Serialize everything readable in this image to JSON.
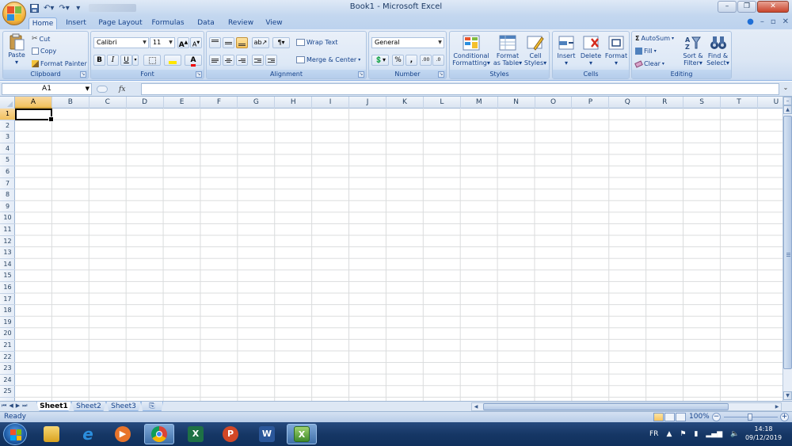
{
  "window": {
    "title": "Book1 - Microsoft Excel"
  },
  "tabs": [
    "Home",
    "Insert",
    "Page Layout",
    "Formulas",
    "Data",
    "Review",
    "View"
  ],
  "ribbon": {
    "clipboard": {
      "paste": "Paste",
      "cut": "Cut",
      "copy": "Copy",
      "format_painter": "Format Painter",
      "label": "Clipboard"
    },
    "font": {
      "name": "Calibri",
      "size": "11",
      "bold": "B",
      "italic": "I",
      "underline": "U",
      "grow": "A",
      "shrink": "A",
      "color_a": "A",
      "label": "Font"
    },
    "alignment": {
      "wrap_text": "Wrap Text",
      "merge_center": "Merge & Center",
      "label": "Alignment"
    },
    "number": {
      "format": "General",
      "percent": "%",
      "comma": ",",
      "inc_dec": ".00",
      "dec_dec": ".0",
      "label": "Number"
    },
    "styles": {
      "conditional": "Conditional",
      "conditional2": "Formatting",
      "format_table": "Format",
      "format_table2": "as Table",
      "cell_styles": "Cell",
      "cell_styles2": "Styles",
      "label": "Styles"
    },
    "cells": {
      "insert": "Insert",
      "delete": "Delete",
      "format": "Format",
      "label": "Cells"
    },
    "editing": {
      "autosum": "AutoSum",
      "fill": "Fill",
      "clear": "Clear",
      "sort_filter": "Sort &",
      "sort_filter2": "Filter",
      "find_select": "Find &",
      "find_select2": "Select",
      "label": "Editing"
    }
  },
  "formula_bar": {
    "name_box": "A1",
    "fx": "fx",
    "formula": ""
  },
  "columns": [
    "A",
    "B",
    "C",
    "D",
    "E",
    "F",
    "G",
    "H",
    "I",
    "J",
    "K",
    "L",
    "M",
    "N",
    "O",
    "P",
    "Q",
    "R",
    "S",
    "T",
    "U"
  ],
  "rows": [
    "1",
    "2",
    "3",
    "4",
    "5",
    "6",
    "7",
    "8",
    "9",
    "10",
    "11",
    "12",
    "13",
    "14",
    "15",
    "16",
    "17",
    "18",
    "19",
    "20",
    "21",
    "22",
    "23",
    "24",
    "25"
  ],
  "sheets": [
    "Sheet1",
    "Sheet2",
    "Sheet3"
  ],
  "status": {
    "text": "Ready",
    "zoom": "100%",
    "zoom_minus": "−",
    "zoom_plus": "+"
  },
  "taskbar": {
    "language": "FR",
    "time": "14:18",
    "date": "09/12/2019"
  },
  "colors": {
    "accent": "#15428b",
    "active_header": "#f1c15f"
  }
}
